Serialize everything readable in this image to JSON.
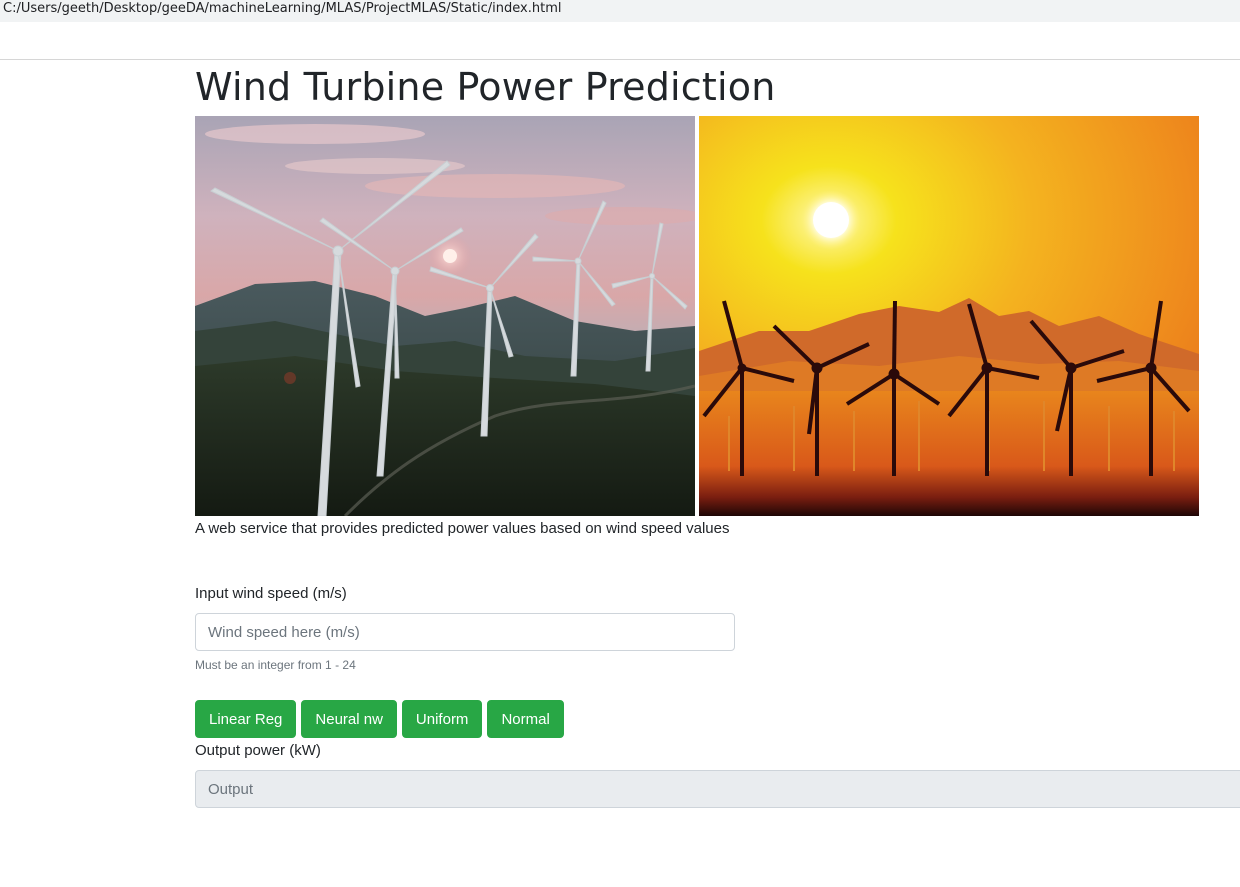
{
  "browser": {
    "address": "C:/Users/geeth/Desktop/geeDA/machineLearning/MLAS/ProjectMLAS/Static/index.html"
  },
  "page": {
    "title": "Wind Turbine Power Prediction",
    "subtitle": "A web service that provides predicted power values based on wind speed values"
  },
  "form": {
    "input_label": "Input wind speed (m/s)",
    "input_placeholder": "Wind speed here (m/s)",
    "input_value": "",
    "help_text": "Must be an integer from 1 - 24",
    "buttons": [
      "Linear Reg",
      "Neural nw",
      "Uniform",
      "Normal"
    ],
    "output_label": "Output power (kW)",
    "output_placeholder": "Output",
    "output_value": ""
  },
  "colors": {
    "button_green": "#28a745",
    "output_bg": "#e9ecef"
  }
}
